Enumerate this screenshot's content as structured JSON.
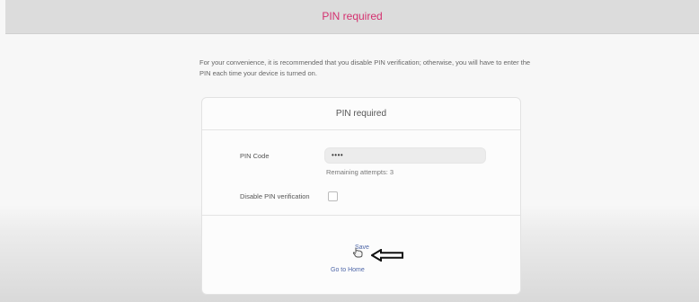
{
  "header": {
    "title": "PIN required"
  },
  "intro_text": "For your convenience, it is recommended that you disable PIN verification; otherwise, you will have to enter the PIN each time your device is turned on.",
  "card": {
    "title": "PIN required",
    "pin_label": "PIN Code",
    "pin_value": "••••",
    "remaining_label": "Remaining attempts:",
    "remaining_count": "3",
    "disable_label": "Disable PIN verification",
    "disable_checked": false,
    "save_label": "Save",
    "home_label": "Go to Home"
  },
  "icons": {
    "cursor": "hand-pointer-icon",
    "annotation": "left-arrow-icon"
  },
  "colors": {
    "header_title": "#d4306f",
    "link": "#4f67a8",
    "header_bg": "#dcdcdc"
  }
}
